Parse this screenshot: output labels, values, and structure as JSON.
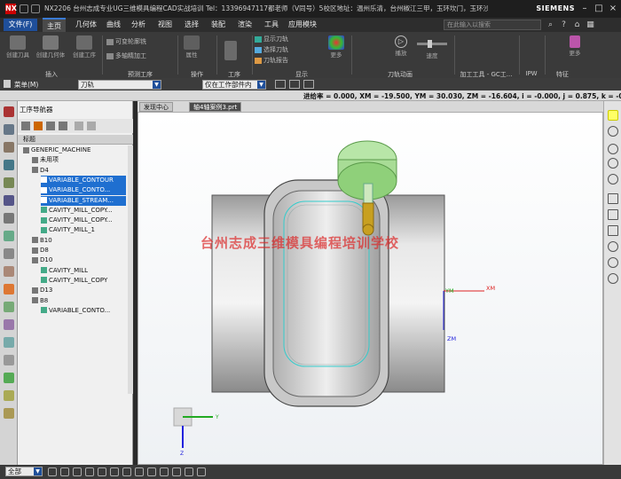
{
  "title_bar": {
    "app_title": "NX2206 台州志成专业UG三维模具编程CAD实战培训 Tel：13396947117都老师（V同号）5校区地址：温州乐清，台州椒江三甲，玉环坎门，玉环沙门，玉环玖门 - 加工",
    "brand": "SIEMENS"
  },
  "menu": {
    "file": "文件(F)",
    "tabs": [
      "主页",
      "几何体",
      "曲线",
      "分析",
      "视图",
      "选择",
      "装配",
      "渲染",
      "工具",
      "应用模块"
    ],
    "active_tab": "主页",
    "search_placeholder": "在此输入以搜索"
  },
  "ribbon": {
    "buttons": {
      "create_tool": "创建刀具",
      "create_geometry": "创建几何体",
      "create_operation": "创建工序",
      "variable_contour": "可变轮廓铣",
      "multi_axis_finish": "多轴精加工",
      "attribute": "属性",
      "more": "更多",
      "play": "播放",
      "speed": "速度"
    },
    "small": {
      "show_toolpath": "显示刀轨",
      "select_toolpath": "选择刀轨",
      "toolpath_report": "刀轨报告"
    },
    "groups": [
      "插入",
      "预测工序",
      "操作",
      "工序",
      "显示",
      "刀轨动画",
      "加工工具 - GC工...",
      "IPW",
      "特征"
    ]
  },
  "selection_bar": {
    "menu_label": "菜单(M)",
    "filter_value": "刀轨",
    "scope_value": "仅在工作部件内"
  },
  "status": {
    "text": "进给率 = 0.000, XM = -19.500, YM = 30.030, ZM = -16.604, i = -0.000, j = 0.875, k = -0.484"
  },
  "navigator": {
    "title": "工序导航器",
    "column_header": "标题",
    "rows": [
      {
        "label": "GENERIC_MACHINE",
        "level": 0,
        "highlight": false
      },
      {
        "label": "未用项",
        "level": 1,
        "highlight": false
      },
      {
        "label": "D4",
        "level": 1,
        "highlight": false
      },
      {
        "label": "VARIABLE_CONTOUR",
        "level": 2,
        "highlight": true
      },
      {
        "label": "VARIABLE_CONTO...",
        "level": 2,
        "highlight": true
      },
      {
        "label": "VARIABLE_STREAM...",
        "level": 2,
        "highlight": true
      },
      {
        "label": "CAVITY_MILL_COPY...",
        "level": 2,
        "highlight": false
      },
      {
        "label": "CAVITY_MILL_COPY...",
        "level": 2,
        "highlight": false
      },
      {
        "label": "CAVITY_MILL_1",
        "level": 2,
        "highlight": false
      },
      {
        "label": "B10",
        "level": 1,
        "highlight": false
      },
      {
        "label": "D8",
        "level": 1,
        "highlight": false
      },
      {
        "label": "D10",
        "level": 1,
        "highlight": false
      },
      {
        "label": "CAVITY_MILL",
        "level": 2,
        "highlight": false
      },
      {
        "label": "CAVITY_MILL_COPY",
        "level": 2,
        "highlight": false
      },
      {
        "label": "D13",
        "level": 1,
        "highlight": false
      },
      {
        "label": "B8",
        "level": 1,
        "highlight": false
      },
      {
        "label": "VARIABLE_CONTO...",
        "level": 2,
        "highlight": false
      }
    ]
  },
  "view_tabs": [
    "发现中心",
    "轴4轴案例3.prt"
  ],
  "viewport": {
    "watermark": "台州志成三维模具编程培训学校",
    "axis_xm": "XM",
    "axis_ym": "YM",
    "axis_zm": "ZM",
    "triad_y": "Y",
    "triad_z": "Z"
  },
  "bottom": {
    "filter_value": "全部"
  },
  "colors": {
    "accent": "#1f6fd0",
    "tool_green": "#8fd07a",
    "holder_yellow": "#c8a020",
    "watermark_red": "#dc2828"
  }
}
